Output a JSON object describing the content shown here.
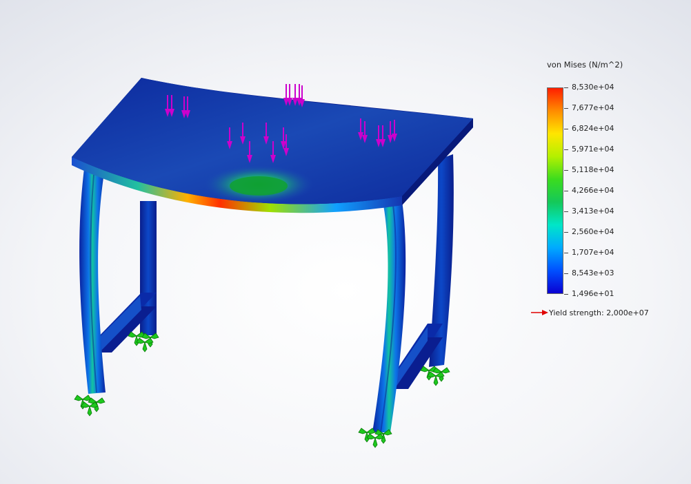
{
  "legend": {
    "title": "von Mises (N/m^2)",
    "ticks": [
      "8,530e+04",
      "7,677e+04",
      "6,824e+04",
      "5,971e+04",
      "5,118e+04",
      "4,266e+04",
      "3,413e+04",
      "2,560e+04",
      "1,707e+04",
      "8,543e+03",
      "1,496e+01"
    ],
    "colors": [
      "#ff1e00",
      "#ff8c00",
      "#ffe600",
      "#b4f000",
      "#3cdc1e",
      "#14c85a",
      "#00e6c8",
      "#00aaff",
      "#0050ff",
      "#0a00d2"
    ],
    "yield_label": "Yield strength: 2,000e+07"
  },
  "colors": {
    "model_blue": "#1232a8",
    "load_arrow": "#cc00cc",
    "fixture": "#1ec81e",
    "yield_arrow": "#e00000"
  }
}
